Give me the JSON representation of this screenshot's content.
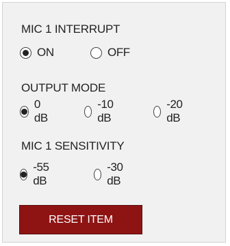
{
  "mic_interrupt": {
    "title": "MIC 1 INTERRUPT",
    "options": [
      {
        "label": "ON",
        "selected": true
      },
      {
        "label": "OFF",
        "selected": false
      }
    ]
  },
  "output_mode": {
    "title": "OUTPUT MODE",
    "options": [
      {
        "label": "0 dB",
        "selected": true
      },
      {
        "label": "-10 dB",
        "selected": false
      },
      {
        "label": "-20 dB",
        "selected": false
      }
    ]
  },
  "mic_sensitivity": {
    "title": "MIC 1 SENSITIVITY",
    "options": [
      {
        "label": "-55 dB",
        "selected": true
      },
      {
        "label": "-30 dB",
        "selected": false
      }
    ]
  },
  "reset_button": {
    "label": "RESET ITEM",
    "color": "#8e1414"
  }
}
